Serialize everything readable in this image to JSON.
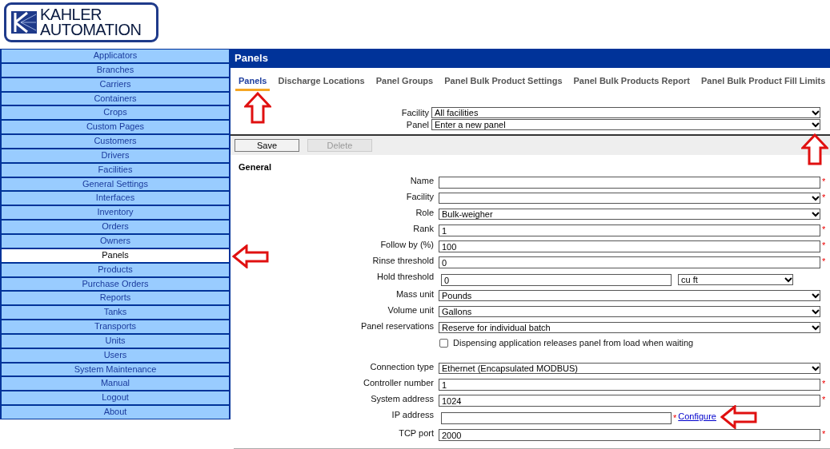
{
  "logo": {
    "line_1": "KAHLER",
    "line_2": "AUTOMATION"
  },
  "sidebar": {
    "items": [
      {
        "label": "Applicators",
        "selected": false
      },
      {
        "label": "Branches",
        "selected": false
      },
      {
        "label": "Carriers",
        "selected": false
      },
      {
        "label": "Containers",
        "selected": false
      },
      {
        "label": "Crops",
        "selected": false
      },
      {
        "label": "Custom Pages",
        "selected": false
      },
      {
        "label": "Customers",
        "selected": false
      },
      {
        "label": "Drivers",
        "selected": false
      },
      {
        "label": "Facilities",
        "selected": false
      },
      {
        "label": "General Settings",
        "selected": false
      },
      {
        "label": "Interfaces",
        "selected": false
      },
      {
        "label": "Inventory",
        "selected": false
      },
      {
        "label": "Orders",
        "selected": false
      },
      {
        "label": "Owners",
        "selected": false
      },
      {
        "label": "Panels",
        "selected": true
      },
      {
        "label": "Products",
        "selected": false
      },
      {
        "label": "Purchase Orders",
        "selected": false
      },
      {
        "label": "Reports",
        "selected": false
      },
      {
        "label": "Tanks",
        "selected": false
      },
      {
        "label": "Transports",
        "selected": false
      },
      {
        "label": "Units",
        "selected": false
      },
      {
        "label": "Users",
        "selected": false
      },
      {
        "label": "System Maintenance",
        "selected": false
      },
      {
        "label": "Manual",
        "selected": false
      },
      {
        "label": "Logout",
        "selected": false
      },
      {
        "label": "About",
        "selected": false
      }
    ]
  },
  "page_title": "Panels",
  "tabs": [
    {
      "label": "Panels",
      "selected": true
    },
    {
      "label": "Discharge Locations",
      "selected": false
    },
    {
      "label": "Panel Groups",
      "selected": false
    },
    {
      "label": "Panel Bulk Product Settings",
      "selected": false
    },
    {
      "label": "Panel Bulk Products Report",
      "selected": false
    },
    {
      "label": "Panel Bulk Product Fill Limits",
      "selected": false
    }
  ],
  "filters": [
    {
      "label": "Facility",
      "value": "All facilities"
    },
    {
      "label": "Panel",
      "value": "Enter a new panel"
    }
  ],
  "toolbar": [
    {
      "label": "Save",
      "disabled": false
    },
    {
      "label": "Delete",
      "disabled": true
    }
  ],
  "section_title": "General",
  "fields": [
    {
      "kind": "text",
      "label": "Name",
      "mark": "*"
    },
    {
      "kind": "select",
      "label": "Facility",
      "mark": "*"
    },
    {
      "kind": "select",
      "label": "Role",
      "value": "Bulk-weigher"
    },
    {
      "kind": "text",
      "label": "Rank",
      "value": "1",
      "mark": "*"
    },
    {
      "kind": "text",
      "label": "Follow by (%)",
      "value": "100",
      "mark": "*"
    },
    {
      "kind": "text",
      "label": "Rinse threshold",
      "value": "0",
      "mark": "*"
    },
    {
      "kind": "hold",
      "label": "Hold threshold",
      "value": "0",
      "unit": "cu ft"
    },
    {
      "kind": "select",
      "label": "Mass unit",
      "value": "Pounds"
    },
    {
      "kind": "select",
      "label": "Volume unit",
      "value": "Gallons"
    },
    {
      "kind": "select",
      "label": "Panel reservations",
      "value": "Reserve for individual batch"
    },
    {
      "kind": "checkbox",
      "label": "Dispensing application releases panel from load when waiting",
      "checked": false
    },
    {
      "kind": "gap"
    },
    {
      "kind": "select",
      "label": "Connection type",
      "value": "Ethernet (Encapsulated MODBUS)"
    },
    {
      "kind": "text",
      "label": "Controller number",
      "value": "1",
      "mark": "*"
    },
    {
      "kind": "text",
      "label": "System address",
      "value": "1024",
      "mark": "*"
    },
    {
      "kind": "link",
      "label": "IP address",
      "mark": "*",
      "link": "Configure"
    },
    {
      "kind": "text",
      "label": "TCP port",
      "value": "2000",
      "mark": "*"
    }
  ]
}
